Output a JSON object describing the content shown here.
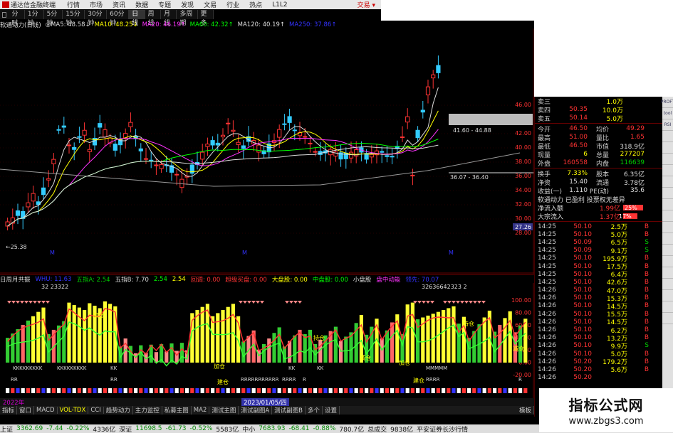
{
  "menu": {
    "title": "通达信金融终端",
    "items": [
      "行情",
      "市场",
      "资讯",
      "数据",
      "专题",
      "发现",
      "文易",
      "行业",
      "热点",
      "L1L2"
    ],
    "right": "交易 ▾"
  },
  "periods": [
    "分时",
    "1分钟",
    "5分钟",
    "15分钟",
    "30分钟",
    "60分钟",
    "日线",
    "周线",
    "月线",
    "多周期",
    "更多"
  ],
  "periods_active": "日线",
  "indicator_line": [
    {
      "t": "软通动力(日线)",
      "c": "#ddd"
    },
    {
      "t": "◎MA5: 48.58↓",
      "c": "#ddd"
    },
    {
      "t": "MA10: 48.25↓",
      "c": "#ff0"
    },
    {
      "t": "MA20: 46.19↑",
      "c": "#f3f"
    },
    {
      "t": "MA60: 42.32↑",
      "c": "#0f0"
    },
    {
      "t": "MA120: 40.19↑",
      "c": "#ddd"
    },
    {
      "t": "MA250: 37.86↑",
      "c": "#33f"
    }
  ],
  "main_labels": {
    "low": "25.38",
    "box_top": "41.60 - 44.88",
    "box_bot": "36.07 - 36.40",
    "marker": "M"
  },
  "price_axis": [
    "46.00",
    "44.00",
    "42.00",
    "40.00",
    "38.00",
    "36.00",
    "34.00",
    "32.00",
    "30.00",
    "28.00"
  ],
  "price_axis_tag": "27.26",
  "sub_line": [
    {
      "t": "日周月共振",
      "c": "#ddd"
    },
    {
      "t": "WHU: 11.63",
      "c": "#33f"
    },
    {
      "t": "五指A: 2.54",
      "c": "#0c0"
    },
    {
      "t": "五指B: 7.70",
      "c": "#ddd"
    },
    {
      "t": "2.54",
      "c": "#0f0"
    },
    {
      "t": "2.54",
      "c": "#ff0"
    },
    {
      "t": "回调: 0.00",
      "c": "#f33"
    },
    {
      "t": "超级买盘: 0.00",
      "c": "#f33"
    },
    {
      "t": "大盘股: 0.00",
      "c": "#ff0"
    },
    {
      "t": "中盘股: 0.00",
      "c": "#0f0"
    },
    {
      "t": "小盘股",
      "c": "#ddd"
    },
    {
      "t": "盘中动能",
      "c": "#f3f"
    },
    {
      "t": "领先: 70.07",
      "c": "#33f"
    }
  ],
  "sub_axis": [
    "100.00",
    "80.00",
    "60.00",
    "40.00",
    "20.00",
    "0.00",
    "-20.00"
  ],
  "sub_annotations": {
    "nums1": "32   23322",
    "nums2": "32636642323 2",
    "k_rows": [
      "KKKKKKKKK",
      "KKKKKKKKK",
      "KK",
      "KK",
      "KK",
      "MMMMM"
    ],
    "r_rows": [
      "RRRRRRRRRRR",
      "RRRR",
      "RR",
      "RR",
      "RRRR",
      "R",
      "R"
    ],
    "buy": "建仓",
    "hold": "持仓",
    "add": "加仓",
    "sell": "减仓",
    "date": "2023/01/05/四",
    "year": "2022年"
  },
  "tabs": [
    "指标",
    "窗口",
    "MACD",
    "VOL-TDX",
    "CCI",
    "趋势动力",
    "主力监控",
    "私募主图",
    "MA2",
    "测试主图",
    "测试副图A",
    "测试副图B",
    "多个",
    "设置"
  ],
  "tabs_right": "模板",
  "status": [
    {
      "t": "上证",
      "c": "#111"
    },
    {
      "t": "3362.69",
      "c": "#080"
    },
    {
      "t": "-7.44",
      "c": "#080"
    },
    {
      "t": "-0.22%",
      "c": "#080"
    },
    {
      "t": "4336亿",
      "c": "#111"
    },
    {
      "t": "深证",
      "c": "#111"
    },
    {
      "t": "11698.5",
      "c": "#080"
    },
    {
      "t": "-61.73",
      "c": "#080"
    },
    {
      "t": "-0.52%",
      "c": "#080"
    },
    {
      "t": "5583亿",
      "c": "#111"
    },
    {
      "t": "中小",
      "c": "#111"
    },
    {
      "t": "7683.93",
      "c": "#080"
    },
    {
      "t": "-68.41",
      "c": "#080"
    },
    {
      "t": "-0.88%",
      "c": "#080"
    },
    {
      "t": "780.7亿",
      "c": "#111"
    },
    {
      "t": "总成交",
      "c": "#111"
    },
    {
      "t": "9838亿",
      "c": "#111"
    },
    {
      "t": "平安证券长沙行情",
      "c": "#111"
    }
  ],
  "quote": {
    "asks": [
      {
        "l": "卖三",
        "p": "",
        "v": "1.0万",
        "c": "red"
      },
      {
        "l": "卖四",
        "p": "50.35",
        "v": "10.0万",
        "c": "red"
      },
      {
        "l": "卖五",
        "p": "50.14",
        "v": "5.0万",
        "c": "red"
      }
    ],
    "stats": [
      {
        "l": "今开",
        "a": "46.50",
        "al": "均价",
        "b": "49.29",
        "ac": "red",
        "bc": "red"
      },
      {
        "l": "最高",
        "a": "51.00",
        "al": "量比",
        "b": "1.65",
        "ac": "red",
        "bc": "red"
      },
      {
        "l": "最低",
        "a": "46.50",
        "al": "市值",
        "b": "318.9亿",
        "ac": "red",
        "bc": "wht"
      },
      {
        "l": "现量",
        "a": "6",
        "al": "总量",
        "b": "277207",
        "ac": "yel",
        "bc": "yel"
      },
      {
        "l": "外盘",
        "a": "160558",
        "al": "内盘",
        "b": "116639",
        "ac": "red",
        "bc": "grn"
      }
    ],
    "stats2": [
      {
        "l": "换手",
        "a": "7.33%",
        "al": "股本",
        "b": "6.35亿",
        "ac": "yel",
        "bc": "wht"
      },
      {
        "l": "净资",
        "a": "15.40",
        "al": "流通",
        "b": "3.78亿",
        "ac": "wht",
        "bc": "wht"
      },
      {
        "l": "收益(一)",
        "a": "1.110",
        "al": "PE(动)",
        "b": "35.6",
        "ac": "wht",
        "bc": "wht"
      }
    ],
    "info": [
      "软通动力 已盈利 投票权无差异"
    ],
    "flows": [
      {
        "l": "净流入额",
        "v": "1.99亿",
        "pct": "25%"
      },
      {
        "l": "大宗流入",
        "v": "1.37亿",
        "pct": "17%"
      }
    ],
    "ticks": [
      {
        "t": "14:25",
        "p": "50.10",
        "v": "2.5万",
        "d": "B",
        "dc": "red"
      },
      {
        "t": "14:25",
        "p": "50.10",
        "v": "5.0万",
        "d": "B",
        "dc": "red"
      },
      {
        "t": "14:25",
        "p": "50.09",
        "v": "6.5万",
        "d": "S",
        "dc": "grn"
      },
      {
        "t": "14:25",
        "p": "50.09",
        "v": "9.1万",
        "d": "S",
        "dc": "grn"
      },
      {
        "t": "14:25",
        "p": "50.10",
        "v": "195.9万",
        "d": "B",
        "dc": "red"
      },
      {
        "t": "14:25",
        "p": "50.10",
        "v": "17.5万",
        "d": "B",
        "dc": "red"
      },
      {
        "t": "14:25",
        "p": "50.10",
        "v": "6.4万",
        "d": "B",
        "dc": "red"
      },
      {
        "t": "14:25",
        "p": "50.10",
        "v": "42.6万",
        "d": "B",
        "dc": "red"
      },
      {
        "t": "14:26",
        "p": "50.10",
        "v": "47.0万",
        "d": "B",
        "dc": "red"
      },
      {
        "t": "14:26",
        "p": "50.10",
        "v": "15.3万",
        "d": "B",
        "dc": "red"
      },
      {
        "t": "14:26",
        "p": "50.10",
        "v": "14.5万",
        "d": "B",
        "dc": "red"
      },
      {
        "t": "14:26",
        "p": "50.10",
        "v": "15.5万",
        "d": "B",
        "dc": "red"
      },
      {
        "t": "14:26",
        "p": "50.10",
        "v": "14.5万",
        "d": "B",
        "dc": "red"
      },
      {
        "t": "14:26",
        "p": "50.10",
        "v": "6.2万",
        "d": "B",
        "dc": "red"
      },
      {
        "t": "14:26",
        "p": "50.10",
        "v": "13.2万",
        "d": "B",
        "dc": "red"
      },
      {
        "t": "14:26",
        "p": "50.10",
        "v": "9.9万",
        "d": "S",
        "dc": "grn"
      },
      {
        "t": "14:26",
        "p": "50.10",
        "v": "5.0万",
        "d": "B",
        "dc": "red"
      },
      {
        "t": "14:26",
        "p": "50.20",
        "v": "179.2万",
        "d": "B",
        "dc": "red"
      },
      {
        "t": "14:26",
        "p": "50.20",
        "v": "5.6万",
        "d": "B",
        "dc": "red"
      },
      {
        "t": "14:26",
        "p": "50.20",
        "v": "",
        "d": "",
        "dc": "red"
      }
    ]
  },
  "side_buttons": [
    "PROFT",
    "tool",
    "RSI",
    "",
    "",
    "",
    "",
    "",
    "",
    "",
    "",
    "",
    "",
    "",
    "",
    "",
    "",
    "",
    "",
    ""
  ],
  "watermark": {
    "line1": "指标公式网",
    "line2": "www.zbgs3.com"
  },
  "colors": {
    "up": "#f33",
    "down": "#0c0",
    "ma5": "#ddd",
    "ma10": "#ff0",
    "ma20": "#f3f",
    "ma60": "#0f0",
    "ma120": "#ddd",
    "ma250": "#33f"
  }
}
